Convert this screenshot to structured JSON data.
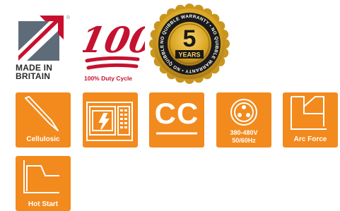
{
  "logo": {
    "made_line1": "MADE IN",
    "made_line2": "BRITAIN",
    "registered_mark": "®"
  },
  "duty_cycle": {
    "number": "100",
    "caption": "100% Duty Cycle"
  },
  "warranty_seal": {
    "number": "5",
    "unit": "YEARS",
    "ring_text": "NO QUIBBLE WARRANTY • NO QUIBBLE WARRANTY • NO QUIBBLE WARRANTY •"
  },
  "features": [
    {
      "label": "Cellulosic",
      "icon": "electrode-icon"
    },
    {
      "label": "",
      "icon": "inverter-machine-icon"
    },
    {
      "label": "CC",
      "icon": ""
    },
    {
      "label_line1": "380-480V",
      "label_line2": "50/60Hz",
      "icon": "three-pin-socket-icon"
    },
    {
      "label": "Arc Force",
      "icon": "arc-force-curve-icon"
    },
    {
      "label": "Hot Start",
      "icon": "hot-start-curve-icon"
    }
  ],
  "colors": {
    "tile": "#f28a1d",
    "duty_red": "#c41230",
    "seal_gold": "#d9a521",
    "seal_black": "#1a1a1a"
  }
}
